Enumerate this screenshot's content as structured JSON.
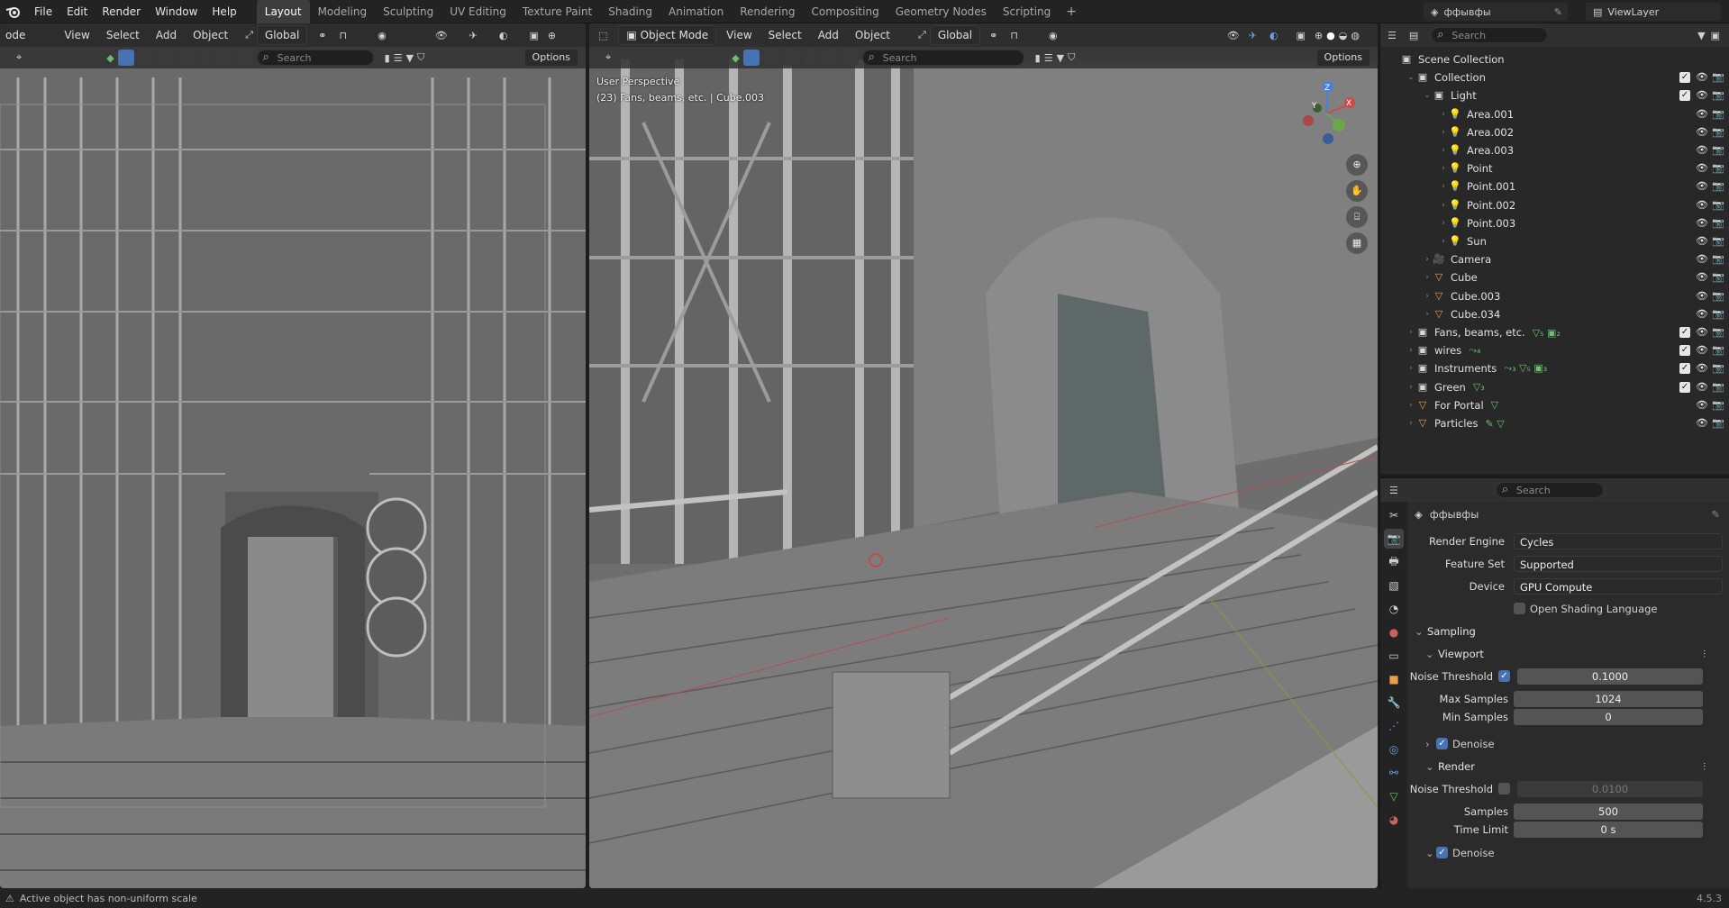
{
  "menu": {
    "items": [
      "File",
      "Edit",
      "Render",
      "Window",
      "Help"
    ],
    "workspaces": [
      "Layout",
      "Modeling",
      "Sculpting",
      "UV Editing",
      "Texture Paint",
      "Shading",
      "Animation",
      "Rendering",
      "Compositing",
      "Geometry Nodes",
      "Scripting"
    ],
    "active_workspace": "Layout",
    "add_tab": "+"
  },
  "scene_name": "ффывфы",
  "view_layer": "ViewLayer",
  "left_viewport": {
    "menus": [
      "View",
      "Select",
      "Add",
      "Object"
    ],
    "mode_partial": "ode",
    "transform": "Global",
    "search_placeholder": "Search",
    "options": "Options"
  },
  "right_viewport": {
    "mode": "Object Mode",
    "menus": [
      "View",
      "Select",
      "Add",
      "Object"
    ],
    "transform": "Global",
    "search_placeholder": "Search",
    "options": "Options",
    "overlay_line1": "User Perspective",
    "overlay_line2": "(23) Fans, beams, etc. | Cube.003",
    "gizmo": {
      "x": "X",
      "y": "Y",
      "z": "Z"
    }
  },
  "outliner": {
    "search_placeholder": "Search",
    "rows": [
      {
        "name": "Scene Collection",
        "depth": 0,
        "icon": "collection",
        "twisty": ""
      },
      {
        "name": "Collection",
        "depth": 1,
        "icon": "collection",
        "twisty": "⌄"
      },
      {
        "name": "Light",
        "depth": 2,
        "icon": "collection",
        "twisty": "⌄"
      },
      {
        "name": "Area.001",
        "depth": 3,
        "icon": "light",
        "twisty": "›"
      },
      {
        "name": "Area.002",
        "depth": 3,
        "icon": "light",
        "twisty": "›"
      },
      {
        "name": "Area.003",
        "depth": 3,
        "icon": "light",
        "twisty": "›"
      },
      {
        "name": "Point",
        "depth": 3,
        "icon": "light",
        "twisty": "›"
      },
      {
        "name": "Point.001",
        "depth": 3,
        "icon": "light",
        "twisty": "›"
      },
      {
        "name": "Point.002",
        "depth": 3,
        "icon": "light",
        "twisty": "›"
      },
      {
        "name": "Point.003",
        "depth": 3,
        "icon": "light",
        "twisty": "›"
      },
      {
        "name": "Sun",
        "depth": 3,
        "icon": "light",
        "twisty": "›"
      },
      {
        "name": "Camera",
        "depth": 2,
        "icon": "camera",
        "twisty": "›"
      },
      {
        "name": "Cube",
        "depth": 2,
        "icon": "mesh",
        "twisty": "›"
      },
      {
        "name": "Cube.003",
        "depth": 2,
        "icon": "mesh",
        "twisty": "›"
      },
      {
        "name": "Cube.034",
        "depth": 2,
        "icon": "mesh",
        "twisty": "›"
      },
      {
        "name": "Fans, beams, etc.",
        "depth": 1,
        "icon": "collection",
        "twisty": "›",
        "extra": "▽₅ ▣₂"
      },
      {
        "name": "wires",
        "depth": 1,
        "icon": "collection",
        "twisty": "›",
        "extra": "⤳₄"
      },
      {
        "name": "Instruments",
        "depth": 1,
        "icon": "collection",
        "twisty": "›",
        "extra": "⤳₃ ▽₅ ▣₃"
      },
      {
        "name": "Green",
        "depth": 1,
        "icon": "collection",
        "twisty": "›",
        "extra": "▽₃"
      },
      {
        "name": "For Portal",
        "depth": 1,
        "icon": "mesh",
        "twisty": "›",
        "extra": "▽"
      },
      {
        "name": "Particles",
        "depth": 1,
        "icon": "mesh",
        "twisty": "›",
        "extra": "✎ ▽"
      }
    ]
  },
  "properties": {
    "search_placeholder": "Search",
    "scene_name": "ффывфы",
    "render_engine_label": "Render Engine",
    "render_engine": "Cycles",
    "feature_set_label": "Feature Set",
    "feature_set": "Supported",
    "device_label": "Device",
    "device": "GPU Compute",
    "osl_label": "Open Shading Language",
    "sampling": "Sampling",
    "viewport": "Viewport",
    "vp_noise_threshold_label": "Noise Threshold",
    "vp_noise_threshold": "0.1000",
    "vp_max_samples_label": "Max Samples",
    "vp_max_samples": "1024",
    "vp_min_samples_label": "Min Samples",
    "vp_min_samples": "0",
    "denoise": "Denoise",
    "render": "Render",
    "r_noise_threshold_label": "Noise Threshold",
    "r_noise_threshold": "0.0100",
    "r_samples_label": "Samples",
    "r_samples": "500",
    "r_time_limit_label": "Time Limit",
    "r_time_limit": "0 s",
    "denoise2": "Denoise"
  },
  "status": {
    "message": "Active object has non-uniform scale",
    "version": "4.5.3"
  }
}
